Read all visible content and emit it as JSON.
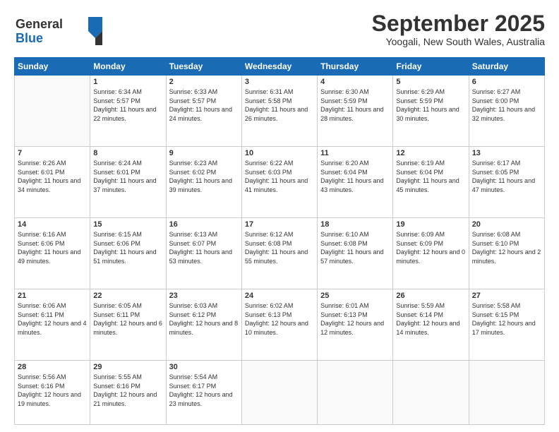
{
  "logo": {
    "line1": "General",
    "line2": "Blue"
  },
  "header": {
    "month": "September 2025",
    "location": "Yoogali, New South Wales, Australia"
  },
  "days_of_week": [
    "Sunday",
    "Monday",
    "Tuesday",
    "Wednesday",
    "Thursday",
    "Friday",
    "Saturday"
  ],
  "weeks": [
    [
      {
        "day": "",
        "empty": true
      },
      {
        "day": "1",
        "sunrise": "6:34 AM",
        "sunset": "5:57 PM",
        "daylight": "11 hours and 22 minutes."
      },
      {
        "day": "2",
        "sunrise": "6:33 AM",
        "sunset": "5:57 PM",
        "daylight": "11 hours and 24 minutes."
      },
      {
        "day": "3",
        "sunrise": "6:31 AM",
        "sunset": "5:58 PM",
        "daylight": "11 hours and 26 minutes."
      },
      {
        "day": "4",
        "sunrise": "6:30 AM",
        "sunset": "5:59 PM",
        "daylight": "11 hours and 28 minutes."
      },
      {
        "day": "5",
        "sunrise": "6:29 AM",
        "sunset": "5:59 PM",
        "daylight": "11 hours and 30 minutes."
      },
      {
        "day": "6",
        "sunrise": "6:27 AM",
        "sunset": "6:00 PM",
        "daylight": "11 hours and 32 minutes."
      }
    ],
    [
      {
        "day": "7",
        "sunrise": "6:26 AM",
        "sunset": "6:01 PM",
        "daylight": "11 hours and 34 minutes."
      },
      {
        "day": "8",
        "sunrise": "6:24 AM",
        "sunset": "6:01 PM",
        "daylight": "11 hours and 37 minutes."
      },
      {
        "day": "9",
        "sunrise": "6:23 AM",
        "sunset": "6:02 PM",
        "daylight": "11 hours and 39 minutes."
      },
      {
        "day": "10",
        "sunrise": "6:22 AM",
        "sunset": "6:03 PM",
        "daylight": "11 hours and 41 minutes."
      },
      {
        "day": "11",
        "sunrise": "6:20 AM",
        "sunset": "6:04 PM",
        "daylight": "11 hours and 43 minutes."
      },
      {
        "day": "12",
        "sunrise": "6:19 AM",
        "sunset": "6:04 PM",
        "daylight": "11 hours and 45 minutes."
      },
      {
        "day": "13",
        "sunrise": "6:17 AM",
        "sunset": "6:05 PM",
        "daylight": "11 hours and 47 minutes."
      }
    ],
    [
      {
        "day": "14",
        "sunrise": "6:16 AM",
        "sunset": "6:06 PM",
        "daylight": "11 hours and 49 minutes."
      },
      {
        "day": "15",
        "sunrise": "6:15 AM",
        "sunset": "6:06 PM",
        "daylight": "11 hours and 51 minutes."
      },
      {
        "day": "16",
        "sunrise": "6:13 AM",
        "sunset": "6:07 PM",
        "daylight": "11 hours and 53 minutes."
      },
      {
        "day": "17",
        "sunrise": "6:12 AM",
        "sunset": "6:08 PM",
        "daylight": "11 hours and 55 minutes."
      },
      {
        "day": "18",
        "sunrise": "6:10 AM",
        "sunset": "6:08 PM",
        "daylight": "11 hours and 57 minutes."
      },
      {
        "day": "19",
        "sunrise": "6:09 AM",
        "sunset": "6:09 PM",
        "daylight": "12 hours and 0 minutes."
      },
      {
        "day": "20",
        "sunrise": "6:08 AM",
        "sunset": "6:10 PM",
        "daylight": "12 hours and 2 minutes."
      }
    ],
    [
      {
        "day": "21",
        "sunrise": "6:06 AM",
        "sunset": "6:11 PM",
        "daylight": "12 hours and 4 minutes."
      },
      {
        "day": "22",
        "sunrise": "6:05 AM",
        "sunset": "6:11 PM",
        "daylight": "12 hours and 6 minutes."
      },
      {
        "day": "23",
        "sunrise": "6:03 AM",
        "sunset": "6:12 PM",
        "daylight": "12 hours and 8 minutes."
      },
      {
        "day": "24",
        "sunrise": "6:02 AM",
        "sunset": "6:13 PM",
        "daylight": "12 hours and 10 minutes."
      },
      {
        "day": "25",
        "sunrise": "6:01 AM",
        "sunset": "6:13 PM",
        "daylight": "12 hours and 12 minutes."
      },
      {
        "day": "26",
        "sunrise": "5:59 AM",
        "sunset": "6:14 PM",
        "daylight": "12 hours and 14 minutes."
      },
      {
        "day": "27",
        "sunrise": "5:58 AM",
        "sunset": "6:15 PM",
        "daylight": "12 hours and 17 minutes."
      }
    ],
    [
      {
        "day": "28",
        "sunrise": "5:56 AM",
        "sunset": "6:16 PM",
        "daylight": "12 hours and 19 minutes."
      },
      {
        "day": "29",
        "sunrise": "5:55 AM",
        "sunset": "6:16 PM",
        "daylight": "12 hours and 21 minutes."
      },
      {
        "day": "30",
        "sunrise": "5:54 AM",
        "sunset": "6:17 PM",
        "daylight": "12 hours and 23 minutes."
      },
      {
        "day": "",
        "empty": true
      },
      {
        "day": "",
        "empty": true
      },
      {
        "day": "",
        "empty": true
      },
      {
        "day": "",
        "empty": true
      }
    ]
  ],
  "labels": {
    "sunrise": "Sunrise:",
    "sunset": "Sunset:",
    "daylight": "Daylight:"
  }
}
